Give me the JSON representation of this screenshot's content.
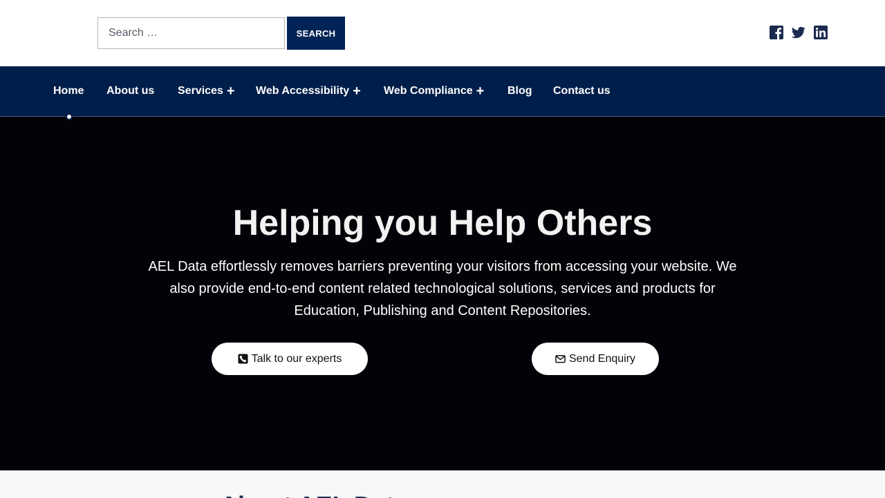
{
  "search": {
    "placeholder": "Search …",
    "button_label": "SEARCH"
  },
  "social": [
    {
      "name": "facebook-icon"
    },
    {
      "name": "twitter-icon"
    },
    {
      "name": "linkedin-icon"
    }
  ],
  "nav": {
    "items": [
      {
        "label": "Home",
        "active": true
      },
      {
        "label": "About us"
      },
      {
        "label": "Services",
        "has_submenu": true
      },
      {
        "label": "Web Accessibility",
        "has_submenu": true
      },
      {
        "label": "Web Compliance",
        "has_submenu": true
      },
      {
        "label": "Blog"
      },
      {
        "label": "Contact us"
      }
    ],
    "submenu_indicator": "+"
  },
  "hero": {
    "title": "Helping you Help Others",
    "text": "AEL Data effortlessly removes barriers preventing your visitors from accessing your website. We also provide end-to-end content related technological solutions, services and products for Education, Publishing and Content Repositories.",
    "buttons": [
      {
        "label": "Talk to our experts",
        "icon": "phone-icon"
      },
      {
        "label": "Send Enquiry",
        "icon": "envelope-icon"
      }
    ]
  },
  "about": {
    "heading": "About AEL Data"
  },
  "colors": {
    "brand_navy": "#002457",
    "nav_background": "#001e4a",
    "hero_background": "#030208",
    "icon_color": "#1b2a4e"
  }
}
